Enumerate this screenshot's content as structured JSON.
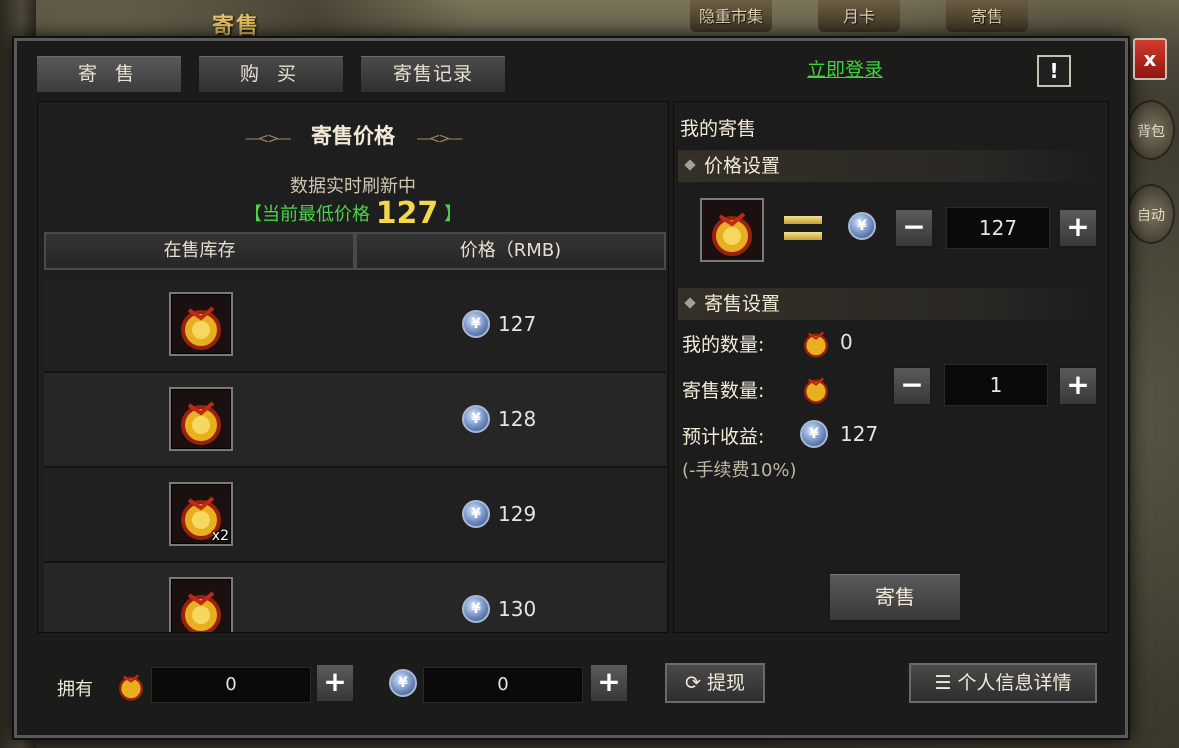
{
  "background": {
    "title": "寄售",
    "top_icons": [
      "隐重市集",
      "月卡",
      "寄售"
    ],
    "side_icons": [
      "背包",
      "自动"
    ]
  },
  "dialog": {
    "tabs": [
      {
        "label": "寄 售",
        "active": true
      },
      {
        "label": "购 买",
        "active": false
      },
      {
        "label": "寄售记录",
        "active": false
      }
    ],
    "login_link": "立即登录",
    "info_icon": "!",
    "close_icon": "x"
  },
  "left_panel": {
    "title": "寄售价格",
    "refresh_text": "数据实时刷新中",
    "lowest_price_prefix": "【当前最低价格",
    "lowest_price_value": "127",
    "lowest_price_suffix": "】",
    "columns": [
      "在售库存",
      "价格（RMB)"
    ],
    "rows": [
      {
        "item_icon": "gold-bag-icon",
        "qty": "",
        "price": "127"
      },
      {
        "item_icon": "gold-bag-icon",
        "qty": "",
        "price": "128"
      },
      {
        "item_icon": "gold-bag-icon",
        "qty": "x2",
        "price": "129"
      },
      {
        "item_icon": "gold-bag-icon",
        "qty": "",
        "price": "130"
      }
    ]
  },
  "right_panel": {
    "title": "我的寄售",
    "price_section": "价格设置",
    "price_value": "127",
    "sale_section": "寄售设置",
    "my_qty_label": "我的数量:",
    "my_qty_value": "0",
    "sell_qty_label": "寄售数量:",
    "sell_qty_value": "1",
    "income_label": "预计收益:",
    "income_value": "127",
    "fee_note": "(-手续费10%)",
    "sell_button": "寄售"
  },
  "bottom_bar": {
    "own_label": "拥有",
    "bag_count": "0",
    "coin_count": "0",
    "withdraw_button": "提现",
    "profile_button": "个人信息详情"
  },
  "colors": {
    "accent_green": "#3fd43a",
    "accent_gold": "#f4d84a",
    "close_red": "#d23a2c"
  }
}
